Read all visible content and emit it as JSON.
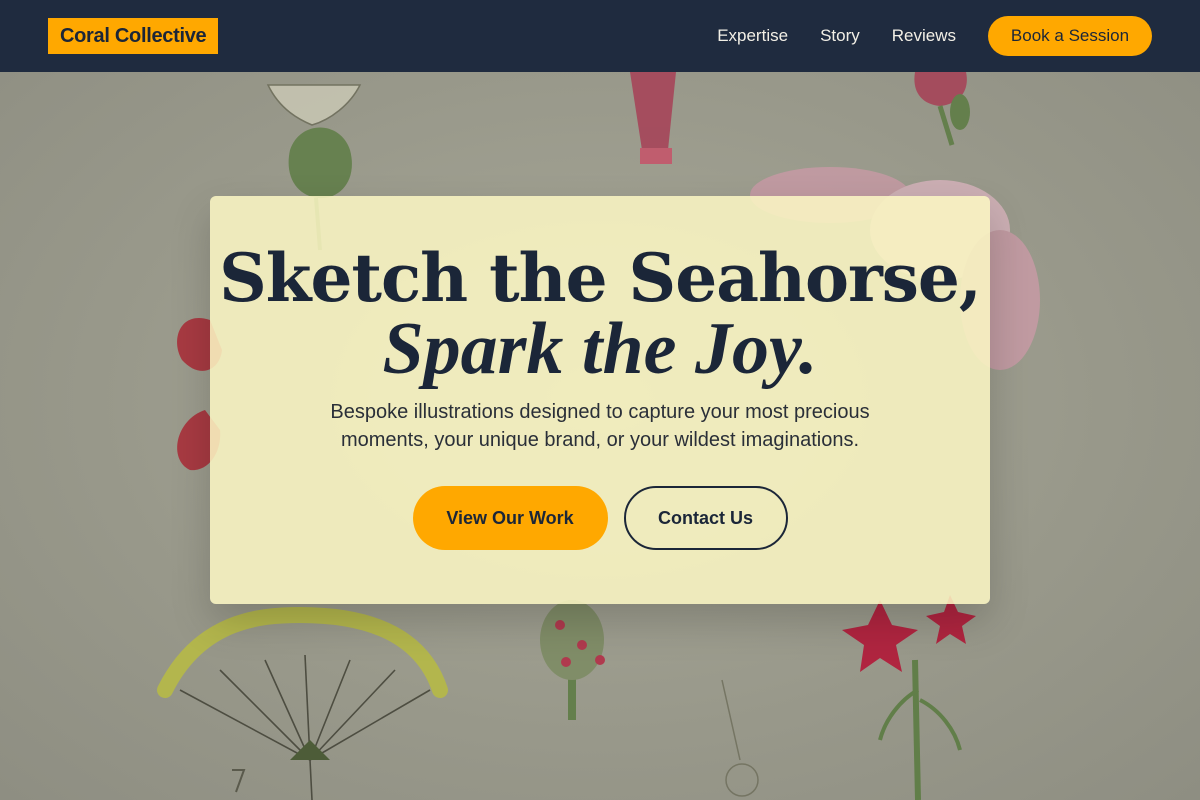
{
  "nav": {
    "logo": "Coral Collective",
    "links": [
      "Expertise",
      "Story",
      "Reviews"
    ],
    "cta": "Book a Session"
  },
  "hero": {
    "title_line1": "Sketch the Seahorse,",
    "title_line2": "Spark the Joy.",
    "subtitle": "Bespoke illustrations designed to capture your most precious moments, your unique brand, or your wildest imaginations.",
    "primary_button": "View Our Work",
    "secondary_button": "Contact Us"
  },
  "colors": {
    "navy": "#1b2638",
    "accent": "#ffa800",
    "card": "#fcf7c4"
  }
}
